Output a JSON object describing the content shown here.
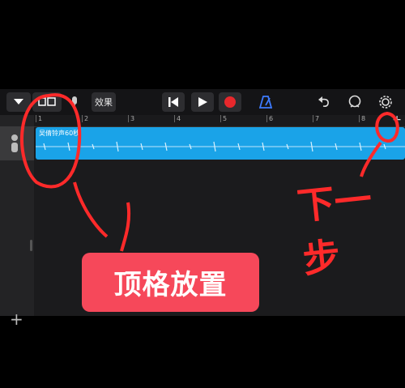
{
  "toolbar": {
    "effects_label": "效果",
    "icons": [
      "chevron-down-icon",
      "view-toggle-icon",
      "mic-icon",
      "rewind-icon",
      "play-icon",
      "record-icon",
      "metronome-icon",
      "undo-icon",
      "loop-icon",
      "settings-icon"
    ]
  },
  "ruler": {
    "ticks": [
      "1",
      "2",
      "3",
      "4",
      "5",
      "6",
      "7",
      "8"
    ],
    "add_label": "+"
  },
  "region": {
    "label": "吴倩铃声60秒"
  },
  "sidebar": {
    "add_label": "+"
  },
  "annotation": {
    "caption": "顶格放置",
    "handwritten": "下一步",
    "color": "#ff2a2a"
  },
  "colors": {
    "region": "#1aa3e8",
    "record": "#e8282c",
    "accent": "#3d7bff"
  }
}
